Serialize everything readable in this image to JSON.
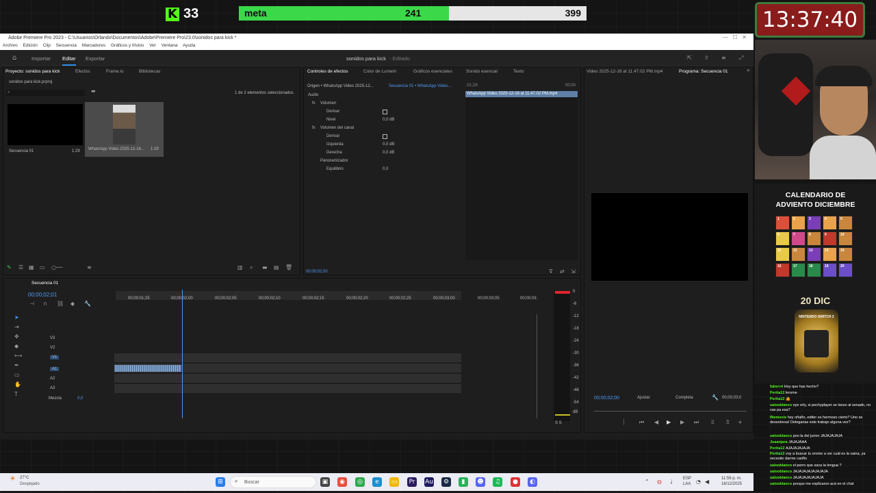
{
  "overlay": {
    "kick_count": "33",
    "meta_label": "meta",
    "meta_current": "241",
    "meta_total": "399",
    "meta_progress": 0.604,
    "clock": "13:37:40",
    "kick_logo_letter": "K"
  },
  "premiere": {
    "title": "Adobe Premiere Pro 2023 - C:\\Usuarios\\Orlando\\Documentos\\Adobe\\Premiere Pro\\23.0\\sonidos para kick *",
    "menu": [
      "Archivo",
      "Edición",
      "Clip",
      "Secuencia",
      "Marcadores",
      "Gráficos y títulos",
      "Ver",
      "Ventana",
      "Ayuda"
    ],
    "workspace_tabs": [
      "Importar",
      "Editar",
      "Exportar"
    ],
    "active_tab": "Editar",
    "project_title": "sonidos para kick",
    "edited_label": "- Editado",
    "project_panel": {
      "tabs": [
        "Proyecto: sonidos para kick",
        "Efectos",
        "Frame.io",
        "Bibliotecas"
      ],
      "file": "sonidos para kick.prproj",
      "selection": "1 de 2 elementos seleccionados",
      "items": [
        {
          "name": "Secuencia 01",
          "duration": "1;29"
        },
        {
          "name": "WhatsApp Video 2025-12-16...",
          "duration": "1:29"
        }
      ]
    },
    "effect_controls": {
      "tabs": [
        "Controles de efectos",
        "Color de Lumetri",
        "Gráficos esenciales",
        "Sonido esencial",
        "Texto"
      ],
      "origin": "Origen • WhatsApp Video 2025-12...",
      "sequence": "Secuencia 01 • WhatsApp Video...",
      "clip_label": "WhatsApp Video 2025-12-16 at 11.47.02 PM.mp4",
      "timecode_small": ";01;29",
      "timecode_end": "00;00",
      "rows": [
        {
          "label": "Audio",
          "value": ""
        },
        {
          "label": "Volumen",
          "value": ""
        },
        {
          "label": "Derivar",
          "value": ""
        },
        {
          "label": "Nivel",
          "value": "0,0 dB"
        },
        {
          "label": "Volumen del canal",
          "value": ""
        },
        {
          "label": "Derivar",
          "value": ""
        },
        {
          "label": "Izquierda",
          "value": "0,0 dB"
        },
        {
          "label": "Derecha",
          "value": "0,0 dB"
        },
        {
          "label": "Panoramizador",
          "value": ""
        },
        {
          "label": "Equilibrio",
          "value": "0,0"
        }
      ],
      "current_time": "00;00;02;00"
    },
    "program_monitor": {
      "source_tab": "Video 2025-12-16 at 11.47.02 PM.mp4",
      "program_tab": "Programa: Secuencia 01",
      "timecode": "00;00;02;00",
      "fit": "Ajustar",
      "quality": "Completa",
      "duration": "00;00;03;0"
    },
    "timeline": {
      "sequence": "Secuencia 01",
      "timecode": "00;00;02;01",
      "ruler": [
        "00;00;01;25",
        "00;00;02;00",
        "00;00;02;05",
        "00;00;02;10",
        "00;00;02;15",
        "00;00;02;20",
        "00;00;02;25",
        "00;00;03;00",
        "00;00;03;05",
        "00;00;03;"
      ],
      "video_tracks": [
        "V3",
        "V2",
        "V1"
      ],
      "audio_tracks": [
        "A1",
        "A2",
        "A3"
      ],
      "mix_label": "Mezcla",
      "mix_value": "0,0",
      "meter_scale": [
        "0",
        "-6",
        "-12",
        "-18",
        "-24",
        "-30",
        "-36",
        "-42",
        "-48",
        "-54",
        "dB"
      ],
      "meter_bottom": "S S"
    }
  },
  "taskbar": {
    "temp": "27°C",
    "weather": "Despejado",
    "search": "Buscar",
    "lang1": "ESP",
    "lang2": "LAA",
    "time": "11:59 p. m.",
    "date": "16/12/2025"
  },
  "calendar": {
    "title_line1": "CALENDARIO DE",
    "title_line2": "ADVIENTO DICIEMBRE",
    "day_label": "20 DIC",
    "prize_label": "NINTENDO SWITCH 2",
    "numbers": [
      "1",
      "2",
      "3",
      "4",
      "5",
      "6",
      "7",
      "8",
      "9",
      "10",
      "11",
      "12",
      "13",
      "14",
      "15",
      "16",
      "17",
      "18",
      "19",
      "20"
    ]
  },
  "chat": [
    {
      "user": "faberrri",
      "text": "Hoy que has hecho?"
    },
    {
      "user": "Perita12",
      "text": "lerome"
    },
    {
      "user": "Perita12",
      "text": "🤷"
    },
    {
      "user": "salooblanco",
      "text": "oye orly, si pechyplayer se lanzo al senado, no vas pa esa?"
    },
    {
      "user": "INemexis",
      "text": "hey oñaño, editer es hermoso cierto? Uno se desestresa! Delegarias este trabajo alguna vez?"
    },
    {
      "user": "salooblanco",
      "text": "pon la del junior JAJAJAJAJA"
    },
    {
      "user": "Juaanjara",
      "text": "JAJAJAAA"
    },
    {
      "user": "Perita12",
      "text": "AJAJAJAJAJA"
    },
    {
      "user": "Perita12",
      "text": "voy a buscar tu erome a ver cuál es la vaina, ya necesito darme cariño"
    },
    {
      "user": "salooblanco",
      "text": "el perro que saca la lengua ?"
    },
    {
      "user": "salooblanco",
      "text": "JAJAJAJAJAJAJAJA"
    },
    {
      "user": "salooblanco",
      "text": "JAJAJAJAJAJAJA"
    },
    {
      "user": "salooblanco",
      "text": "porque me explicaron acá en el chat"
    }
  ]
}
